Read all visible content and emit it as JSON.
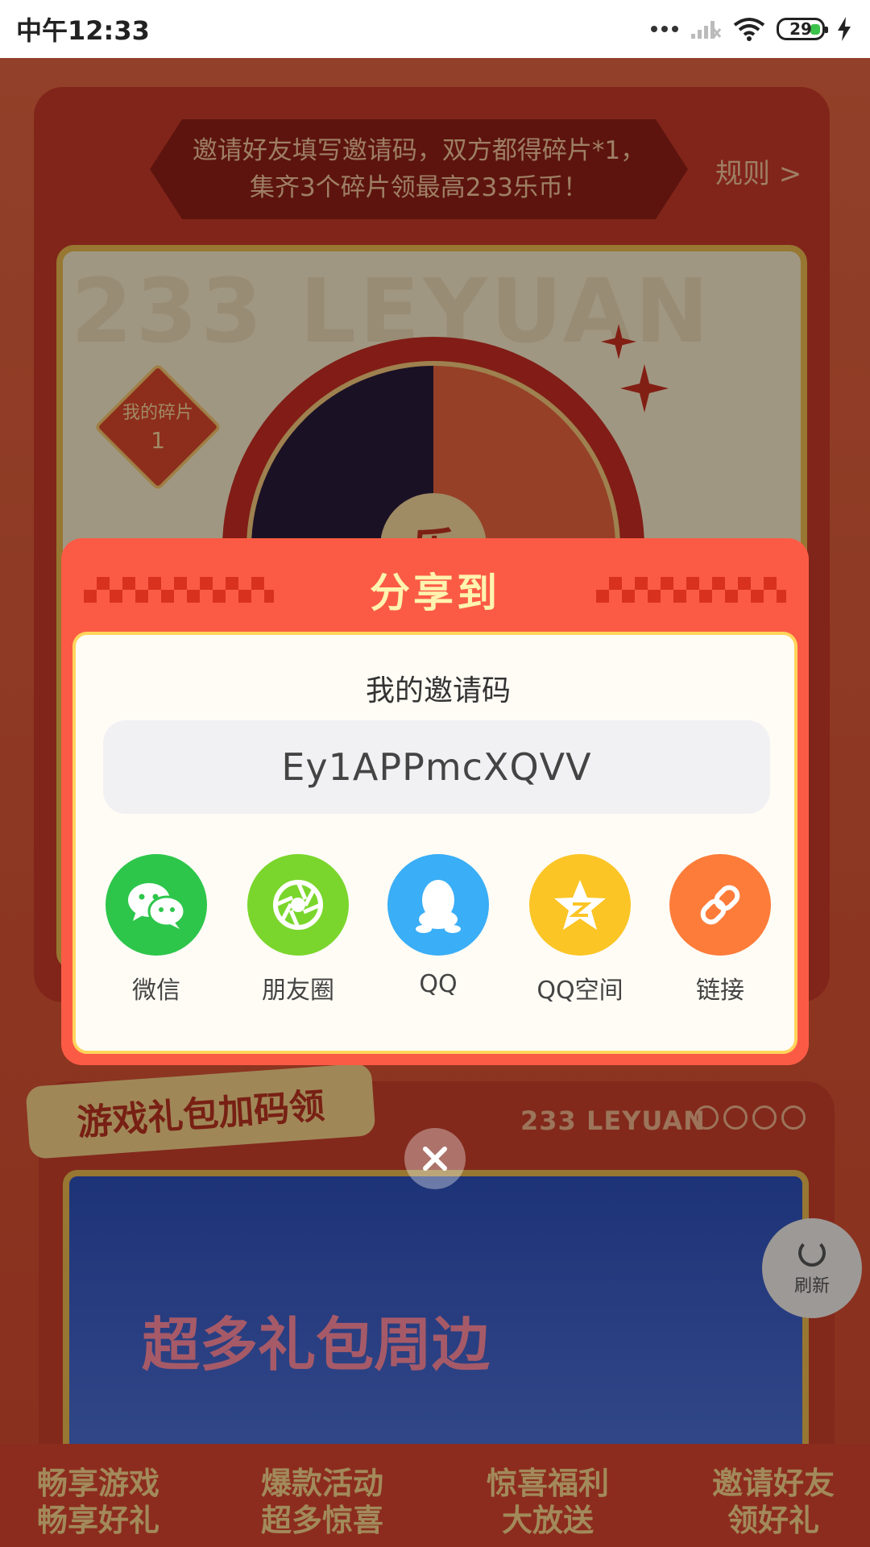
{
  "status_bar": {
    "time": "中午12:33",
    "battery": "29"
  },
  "background": {
    "invite_banner": {
      "line1": "邀请好友填写邀请码，双方都得碎片*1，",
      "line2": "集齐3个碎片领最高233乐币！"
    },
    "rules_link": "规则 >",
    "watermark": "233 LEYUAN",
    "my_fragments_label": "我的碎片",
    "my_fragments_count": "1",
    "wheel_center": "乐",
    "gift_tag": "游戏礼包加码领",
    "leyuan_label": "233 LEYUAN",
    "banner_text": "超多礼包周边",
    "features": [
      {
        "line1": "畅享游戏",
        "line2": "畅享好礼"
      },
      {
        "line1": "爆款活动",
        "line2": "超多惊喜"
      },
      {
        "line1": "惊喜福利",
        "line2": "大放送"
      },
      {
        "line1": "邀请好友",
        "line2": "领好礼"
      }
    ],
    "refresh_label": "刷新"
  },
  "modal": {
    "title": "分享到",
    "code_label": "我的邀请码",
    "invite_code": "Ey1APPmcXQVV",
    "share_targets": [
      {
        "label": "微信",
        "icon": "wechat-icon",
        "color": "#2dc64b"
      },
      {
        "label": "朋友圈",
        "icon": "moments-icon",
        "color": "#7ad62c"
      },
      {
        "label": "QQ",
        "icon": "qq-icon",
        "color": "#3aaef6"
      },
      {
        "label": "QQ空间",
        "icon": "qzone-icon",
        "color": "#fcc526"
      },
      {
        "label": "链接",
        "icon": "link-icon",
        "color": "#fd7c3a"
      }
    ]
  },
  "colors": {
    "modal_bg": "#fb5b45",
    "modal_title": "#fff3b0",
    "accent_border": "#ffd45c"
  }
}
